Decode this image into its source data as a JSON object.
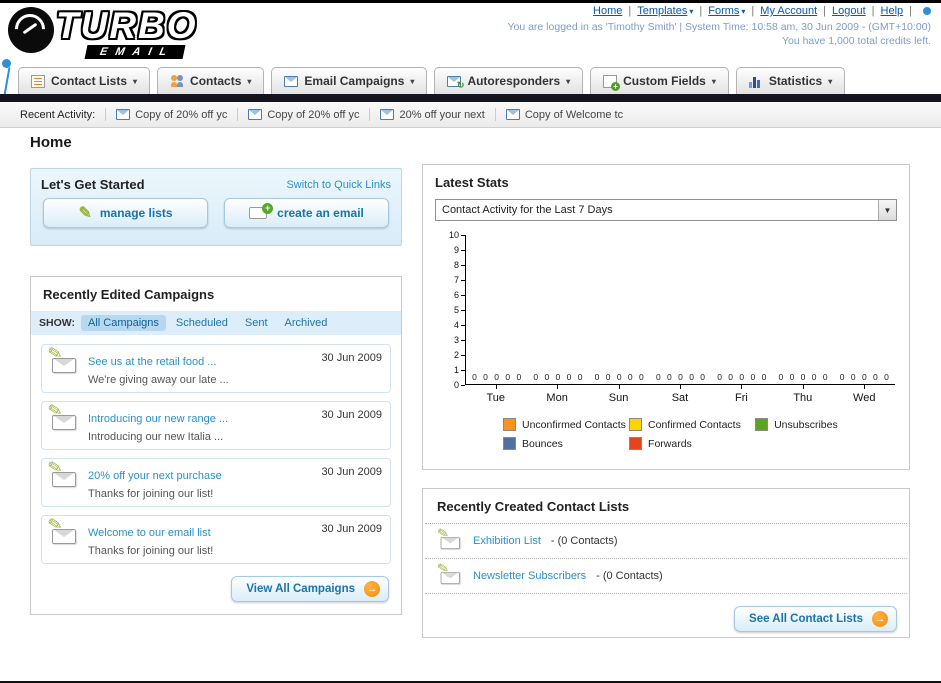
{
  "header": {
    "logo_line1": "TURBO",
    "logo_line2": "EMAIL",
    "links": [
      {
        "label": "Home",
        "dropdown": false
      },
      {
        "label": "Templates",
        "dropdown": true
      },
      {
        "label": "Forms",
        "dropdown": true
      },
      {
        "label": "My Account",
        "dropdown": false
      },
      {
        "label": "Logout",
        "dropdown": false
      },
      {
        "label": "Help",
        "dropdown": false
      }
    ],
    "session_info": "You are logged in as 'Timothy Smith' | System Time: 10:58 am, 30 Jun 2009 - (GMT+10:00)",
    "credits_info": "You have 1,000 total credits left."
  },
  "nav_tabs": [
    {
      "label": "Contact Lists"
    },
    {
      "label": "Contacts"
    },
    {
      "label": "Email Campaigns"
    },
    {
      "label": "Autoresponders"
    },
    {
      "label": "Custom Fields"
    },
    {
      "label": "Statistics"
    }
  ],
  "recent_activity": {
    "label": "Recent Activity:",
    "items": [
      "Copy of 20% off yc",
      "Copy of 20% off yc",
      "20% off your next",
      "Copy of Welcome tc"
    ]
  },
  "page_title": "Home",
  "get_started": {
    "title": "Let's Get Started",
    "switch_link": "Switch to Quick Links",
    "manage_lists_label": "manage lists",
    "create_email_label": "create an email"
  },
  "campaigns": {
    "title": "Recently Edited Campaigns",
    "show_label": "SHOW:",
    "tabs": [
      "All Campaigns",
      "Scheduled",
      "Sent",
      "Archived"
    ],
    "active_tab": "All Campaigns",
    "items": [
      {
        "title": "See us at the retail food ...",
        "subtitle": "We're giving away our late ...",
        "date": "30 Jun 2009"
      },
      {
        "title": "Introducing our new range ...",
        "subtitle": "Introducing our new Italia ...",
        "date": "30 Jun 2009"
      },
      {
        "title": "20% off your next purchase",
        "subtitle": "Thanks for joining our list!",
        "date": "30 Jun 2009"
      },
      {
        "title": "Welcome to our email list",
        "subtitle": "Thanks for joining our list!",
        "date": "30 Jun 2009"
      }
    ],
    "view_all_label": "View All Campaigns"
  },
  "stats": {
    "title": "Latest Stats",
    "period_selector": "Contact Activity for the Last 7 Days",
    "chart_data": {
      "type": "bar",
      "title": "Contact Activity for the Last 7 Days",
      "categories": [
        "Tue",
        "Mon",
        "Sun",
        "Sat",
        "Fri",
        "Thu",
        "Wed"
      ],
      "series": [
        {
          "name": "Unconfirmed Contacts",
          "color": "#f7941d",
          "values": [
            0,
            0,
            0,
            0,
            0,
            0,
            0
          ]
        },
        {
          "name": "Confirmed Contacts",
          "color": "#ffd200",
          "values": [
            0,
            0,
            0,
            0,
            0,
            0,
            0
          ]
        },
        {
          "name": "Unsubscribes",
          "color": "#5da423",
          "values": [
            0,
            0,
            0,
            0,
            0,
            0,
            0
          ]
        },
        {
          "name": "Bounces",
          "color": "#4f6fa5",
          "values": [
            0,
            0,
            0,
            0,
            0,
            0,
            0
          ]
        },
        {
          "name": "Forwards",
          "color": "#e8431f",
          "values": [
            0,
            0,
            0,
            0,
            0,
            0,
            0
          ]
        }
      ],
      "ylim": [
        0,
        10
      ],
      "grid": false,
      "legend_position": "bottom"
    }
  },
  "contact_lists": {
    "title": "Recently Created Contact Lists",
    "items": [
      {
        "name": "Exhibition List",
        "detail": "- (0 Contacts)"
      },
      {
        "name": "Newsletter Subscribers",
        "detail": "- (0 Contacts)"
      }
    ],
    "see_all_label": "See All Contact Lists"
  }
}
